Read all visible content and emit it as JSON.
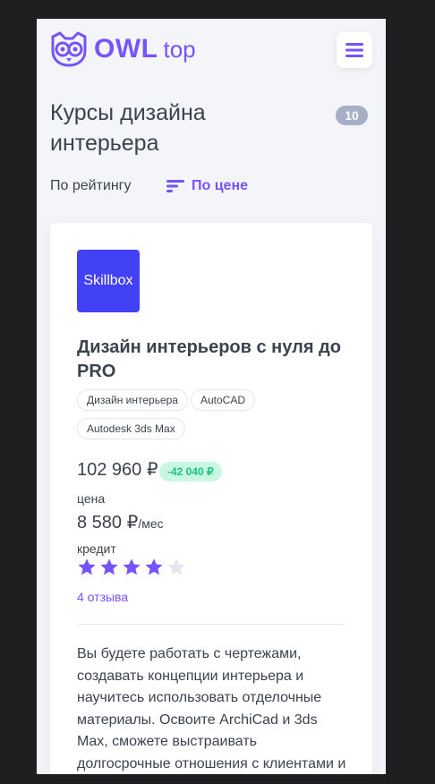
{
  "header": {
    "logo_main": "OWL",
    "logo_sub": "top"
  },
  "page": {
    "title": "Курсы дизайна интерьера",
    "count": "10",
    "sort_rating": "По рейтингу",
    "sort_price": "По цене"
  },
  "course": {
    "brand": "Skillbox",
    "title": "Дизайн интерьеров с нуля до PRO",
    "tags": [
      "Дизайн интерьера",
      "AutoCAD",
      "Autodesk 3ds Max"
    ],
    "price": "102 960 ₽",
    "discount": "-42 040 ₽",
    "price_label": "цена",
    "credit_amount": "8 580 ₽",
    "credit_unit": "/мес",
    "credit_label": "кредит",
    "rating": 4,
    "rating_max": 5,
    "reviews": "4 отзыва",
    "description": "Вы будете работать с чертежами, создавать концепции интерьера и научитесь использовать отделочные материалы. Освоите ArchiCad и 3ds Max, сможете выстраивать долгосрочные отношения с клиентами и"
  },
  "colors": {
    "accent": "#7653fc",
    "brand_bg": "#4341f6",
    "star_active": "#7653fc",
    "star_inactive": "#e3e6ee",
    "discount_bg": "#c8f8e4",
    "discount_text": "#1dc37e"
  }
}
